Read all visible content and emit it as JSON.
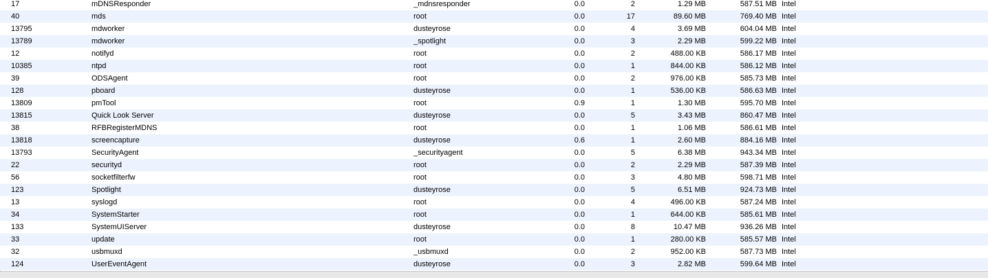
{
  "processes": [
    {
      "pid": "17",
      "name": "mDNSResponder",
      "user": "_mdnsresponder",
      "cpu": "0.0",
      "threads": "2",
      "real_mem": "1.29 MB",
      "virtual_mem": "587.51 MB",
      "kind": "Intel"
    },
    {
      "pid": "40",
      "name": "mds",
      "user": "root",
      "cpu": "0.0",
      "threads": "17",
      "real_mem": "89.60 MB",
      "virtual_mem": "769.40 MB",
      "kind": "Intel"
    },
    {
      "pid": "13795",
      "name": "mdworker",
      "user": "dusteyrose",
      "cpu": "0.0",
      "threads": "4",
      "real_mem": "3.69 MB",
      "virtual_mem": "604.04 MB",
      "kind": "Intel"
    },
    {
      "pid": "13789",
      "name": "mdworker",
      "user": "_spotlight",
      "cpu": "0.0",
      "threads": "3",
      "real_mem": "2.29 MB",
      "virtual_mem": "599.22 MB",
      "kind": "Intel"
    },
    {
      "pid": "12",
      "name": "notifyd",
      "user": "root",
      "cpu": "0.0",
      "threads": "2",
      "real_mem": "488.00 KB",
      "virtual_mem": "586.17 MB",
      "kind": "Intel"
    },
    {
      "pid": "10385",
      "name": "ntpd",
      "user": "root",
      "cpu": "0.0",
      "threads": "1",
      "real_mem": "844.00 KB",
      "virtual_mem": "586.12 MB",
      "kind": "Intel"
    },
    {
      "pid": "39",
      "name": "ODSAgent",
      "user": "root",
      "cpu": "0.0",
      "threads": "2",
      "real_mem": "976.00 KB",
      "virtual_mem": "585.73 MB",
      "kind": "Intel"
    },
    {
      "pid": "128",
      "name": "pboard",
      "user": "dusteyrose",
      "cpu": "0.0",
      "threads": "1",
      "real_mem": "536.00 KB",
      "virtual_mem": "586.63 MB",
      "kind": "Intel"
    },
    {
      "pid": "13809",
      "name": "pmTool",
      "user": "root",
      "cpu": "0.9",
      "threads": "1",
      "real_mem": "1.30 MB",
      "virtual_mem": "595.70 MB",
      "kind": "Intel"
    },
    {
      "pid": "13815",
      "name": "Quick Look Server",
      "user": "dusteyrose",
      "cpu": "0.0",
      "threads": "5",
      "real_mem": "3.43 MB",
      "virtual_mem": "860.47 MB",
      "kind": "Intel"
    },
    {
      "pid": "38",
      "name": "RFBRegisterMDNS",
      "user": "root",
      "cpu": "0.0",
      "threads": "1",
      "real_mem": "1.06 MB",
      "virtual_mem": "586.61 MB",
      "kind": "Intel"
    },
    {
      "pid": "13818",
      "name": "screencapture",
      "user": "dusteyrose",
      "cpu": "0.6",
      "threads": "1",
      "real_mem": "2.60 MB",
      "virtual_mem": "884.16 MB",
      "kind": "Intel"
    },
    {
      "pid": "13793",
      "name": "SecurityAgent",
      "user": "_securityagent",
      "cpu": "0.0",
      "threads": "5",
      "real_mem": "6.38 MB",
      "virtual_mem": "943.34 MB",
      "kind": "Intel"
    },
    {
      "pid": "22",
      "name": "securityd",
      "user": "root",
      "cpu": "0.0",
      "threads": "2",
      "real_mem": "2.29 MB",
      "virtual_mem": "587.39 MB",
      "kind": "Intel"
    },
    {
      "pid": "56",
      "name": "socketfilterfw",
      "user": "root",
      "cpu": "0.0",
      "threads": "3",
      "real_mem": "4.80 MB",
      "virtual_mem": "598.71 MB",
      "kind": "Intel"
    },
    {
      "pid": "123",
      "name": "Spotlight",
      "user": "dusteyrose",
      "cpu": "0.0",
      "threads": "5",
      "real_mem": "6.51 MB",
      "virtual_mem": "924.73 MB",
      "kind": "Intel"
    },
    {
      "pid": "13",
      "name": "syslogd",
      "user": "root",
      "cpu": "0.0",
      "threads": "4",
      "real_mem": "496.00 KB",
      "virtual_mem": "587.24 MB",
      "kind": "Intel"
    },
    {
      "pid": "34",
      "name": "SystemStarter",
      "user": "root",
      "cpu": "0.0",
      "threads": "1",
      "real_mem": "644.00 KB",
      "virtual_mem": "585.61 MB",
      "kind": "Intel"
    },
    {
      "pid": "133",
      "name": "SystemUIServer",
      "user": "dusteyrose",
      "cpu": "0.0",
      "threads": "8",
      "real_mem": "10.47 MB",
      "virtual_mem": "936.26 MB",
      "kind": "Intel"
    },
    {
      "pid": "33",
      "name": "update",
      "user": "root",
      "cpu": "0.0",
      "threads": "1",
      "real_mem": "280.00 KB",
      "virtual_mem": "585.57 MB",
      "kind": "Intel"
    },
    {
      "pid": "32",
      "name": "usbmuxd",
      "user": "_usbmuxd",
      "cpu": "0.0",
      "threads": "2",
      "real_mem": "952.00 KB",
      "virtual_mem": "587.73 MB",
      "kind": "Intel"
    },
    {
      "pid": "124",
      "name": "UserEventAgent",
      "user": "dusteyrose",
      "cpu": "0.0",
      "threads": "3",
      "real_mem": "2.82 MB",
      "virtual_mem": "599.64 MB",
      "kind": "Intel"
    }
  ],
  "colors": {
    "row_even": "#ffffff",
    "row_odd": "#edf3fe",
    "text": "#000000"
  }
}
